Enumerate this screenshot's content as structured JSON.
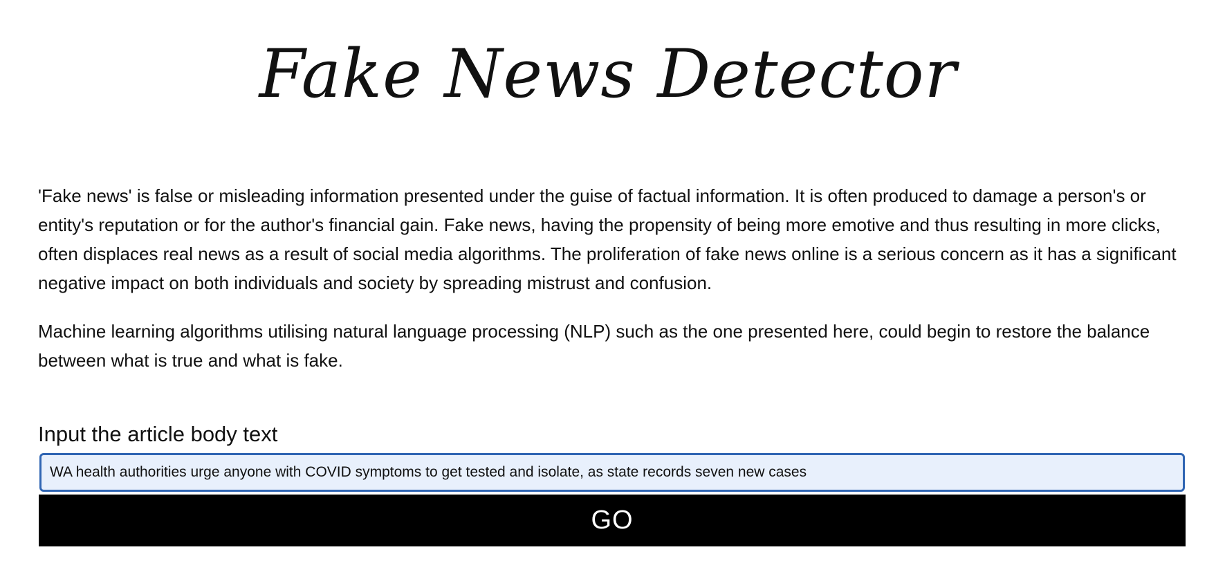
{
  "header": {
    "title": "Fake News Detector"
  },
  "intro": {
    "paragraphs": [
      "'Fake news' is false or misleading information presented under the guise of factual information. It is often produced to damage a person's or entity's reputation or for the author's financial gain. Fake news, having the propensity of being more emotive and thus resulting in more clicks, often displaces real news as a result of social media algorithms. The proliferation of fake news online is a serious concern as it has a significant negative impact on both individuals and society by spreading mistrust and confusion.",
      "Machine learning algorithms utilising natural language processing (NLP) such as the one presented here, could begin to restore the balance between what is true and what is fake."
    ]
  },
  "form": {
    "label": "Input the article body text",
    "input_value": "WA health authorities urge anyone with COVID symptoms to get tested and isolate, as state records seven new cases",
    "button_label": "GO"
  },
  "colors": {
    "input_border": "#2f65b3",
    "input_background": "#e8f0fc",
    "button_background": "#000000",
    "button_text": "#ffffff"
  }
}
